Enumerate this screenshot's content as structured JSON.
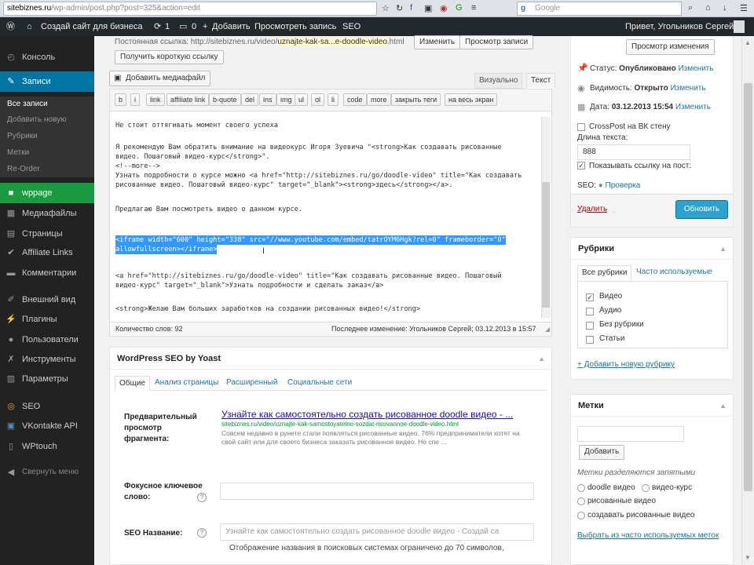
{
  "browser": {
    "url_domain": "sitebiznes.ru",
    "url_path": "/wp-admin/post.php?post=325&action=edit",
    "search_placeholder": "Google",
    "search_engine": "g"
  },
  "adminbar": {
    "site": "Создай сайт для бизнеса",
    "updates": "1",
    "comments": "0",
    "add": "Добавить",
    "preview": "Просмотреть запись",
    "seo": "SEO",
    "greeting": "Привет, Угольников Сергей"
  },
  "sidebar": {
    "items": [
      {
        "label": "Консоль",
        "icon": "dashboard-icon"
      },
      {
        "label": "Записи",
        "icon": "pin-icon"
      },
      {
        "label": "wppage",
        "icon": "wppage-icon"
      },
      {
        "label": "Медиафайлы",
        "icon": "media-icon"
      },
      {
        "label": "Страницы",
        "icon": "pages-icon"
      },
      {
        "label": "Affiliate Links",
        "icon": "affiliate-icon"
      },
      {
        "label": "Комментарии",
        "icon": "comments-icon"
      },
      {
        "label": "Внешний вид",
        "icon": "appearance-icon"
      },
      {
        "label": "Плагины",
        "icon": "plugins-icon"
      },
      {
        "label": "Пользователи",
        "icon": "users-icon"
      },
      {
        "label": "Инструменты",
        "icon": "tools-icon"
      },
      {
        "label": "Параметры",
        "icon": "settings-icon"
      },
      {
        "label": "SEO",
        "icon": "seo-icon"
      },
      {
        "label": "VKontakte API",
        "icon": "vk-icon"
      },
      {
        "label": "WPtouch",
        "icon": "wptouch-icon"
      },
      {
        "label": "Свернуть меню",
        "icon": "collapse-icon"
      }
    ],
    "sub": [
      "Все записи",
      "Добавить новую",
      "Рубрики",
      "Метки",
      "Re-Order"
    ]
  },
  "permalink": {
    "label": "Постоянная ссылка:",
    "base": "http://sitebiznes.ru/video/",
    "slug": "uznajte-kak-sa...e-doodle-video",
    "end": ".html",
    "change": "Изменить",
    "view": "Просмотр записи",
    "short": "Получить короткую ссылку"
  },
  "editor": {
    "add_media": "Добавить медиафайл",
    "tab_visual": "Визуально",
    "tab_text": "Текст",
    "quicktags": [
      "b",
      "i",
      "link",
      "affiliate link",
      "b-quote",
      "del",
      "ins",
      "img",
      "ul",
      "ol",
      "li",
      "code",
      "more",
      "закрыть теги",
      "на весь экран"
    ],
    "lines": [
      "Не стоит оттягивать момент своего успеха",
      "",
      "Я рекомендую Вам обратить внимание на видеокурс Игоря Зуевича \"<strong>Как создавать рисованные",
      "видео. Пошаговый видео-курс</strong>\".",
      "<!--more-->",
      "Узнать подробности о курсе можно <a href=\"http://sitebiznes.ru/go/doodle-video\" title=\"Как создавать",
      "рисованные видео. Пошаговый видео-курс\" target=\"_blank\"><strong>здесь</strong></a>.",
      "",
      "Предлагаю Вам посмотреть видео о данном курсе.",
      "",
      "<iframe width=\"600\" height=\"338\" src=\"//www.youtube.com/embed/tatrOYM6Hgk?rel=0\" frameborder=\"0\"",
      "allowfullscreen></iframe>",
      "",
      "<a href=\"http://sitebiznes.ru/go/doodle-video\" title=\"Как создавать рисованные видео. Пошаговый",
      "видео-курс\" target=\"_blank\">Узнать подробности и сделать заказ</a>",
      "",
      "<strong>Желаю Вам больших заработков на создании рисованных видео!</strong>"
    ],
    "word_count": "Количество слов: 92",
    "last_edit": "Последнее изменение: Угольников Сергей; 03.12.2013 в 15:57"
  },
  "seo": {
    "title": "WordPress SEO by Yoast",
    "tabs": [
      "Общие",
      "Анализ страницы",
      "Расширенный",
      "Социальные сети"
    ],
    "snippet_label": "Предварительный просмотр фрагмента:",
    "snippet_title": "Узнайте как самостоятельно создать рисованное doodle видео - ...",
    "snippet_url": "sitebiznes.ru/video/uznajte-kak-samostoyatelno-sozdat-risovannoe-doodle-video.html",
    "snippet_desc": "Совсем недавно в рунете стали появляться рисованные видео. 76% предприниматели хотят на свой сайт или для своего бизнеса заказать рисованное видео. Но спе ...",
    "focus_label": "Фокусное ключевое слово:",
    "title_label": "SEO Название:",
    "title_placeholder": "Узнайте как самостоятельно создать рисованное doodle видео - Создай са",
    "title_hint": "Отображение названия в поисковых системах ограничено до 70 символов,"
  },
  "publish": {
    "preview_changes": "Просмотр изменения",
    "status": "Статус:",
    "status_val": "Опубликовано",
    "visibility": "Видимость:",
    "visibility_val": "Открыто",
    "date": "Дата:",
    "date_val": "03.12.2013 15:54",
    "change": "Изменить",
    "crosspost": "CrossPost на ВК стену",
    "text_length": "Длина текста:",
    "text_length_val": "888",
    "show_link": "Показывать ссылку на пост:",
    "seo_label": "SEO:",
    "seo_check": "Проверка",
    "delete": "Удалить",
    "update": "Обновить"
  },
  "categories": {
    "title": "Рубрики",
    "tab_all": "Все рубрики",
    "tab_popular": "Часто используемые",
    "items": [
      {
        "label": "Видео",
        "checked": true
      },
      {
        "label": "Аудио",
        "checked": false
      },
      {
        "label": "Без рубрики",
        "checked": false
      },
      {
        "label": "Статьи",
        "checked": false
      }
    ],
    "add": "+ Добавить новую рубрику"
  },
  "tags": {
    "title": "Метки",
    "add": "Добавить",
    "hint": "Метки разделяются запятыми",
    "suggestions": [
      "doodle видео",
      "видео-курс",
      "рисованные видео",
      "создавать рисованные видео"
    ],
    "choose": "Выбрать из часто используемых меток"
  }
}
